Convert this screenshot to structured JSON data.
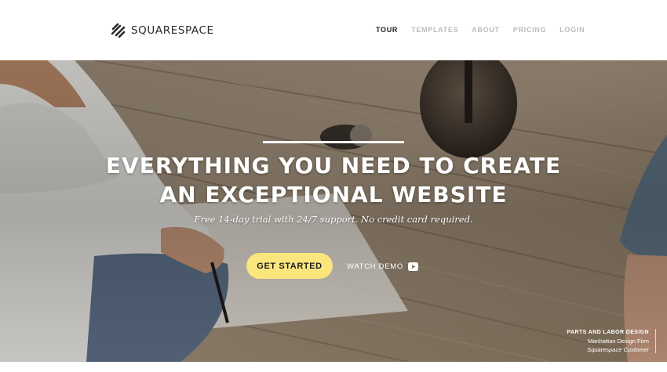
{
  "brand": {
    "name": "SQUARESPACE",
    "icon": "squarespace-logo-icon"
  },
  "nav": {
    "items": [
      {
        "label": "TOUR",
        "active": true
      },
      {
        "label": "TEMPLATES",
        "active": false
      },
      {
        "label": "ABOUT",
        "active": false
      },
      {
        "label": "PRICING",
        "active": false
      },
      {
        "label": "LOGIN",
        "active": false
      }
    ]
  },
  "hero": {
    "headline_line1": "EVERYTHING YOU NEED TO CREATE",
    "headline_line2": "AN EXCEPTIONAL WEBSITE",
    "subheadline": "Free 14-day trial with 24/7 support. No credit card required.",
    "cta_label": "GET STARTED",
    "demo_label": "WATCH DEMO",
    "demo_icon": "play-video-icon"
  },
  "credit": {
    "name": "PARTS AND LABOR DESIGN",
    "role": "Manhattan Design Firm",
    "type": "Squarespace Customer"
  },
  "colors": {
    "cta_background": "#fbe57d",
    "nav_active": "#222222",
    "nav_inactive": "#bcbcbc",
    "text_on_photo": "#ffffff"
  }
}
